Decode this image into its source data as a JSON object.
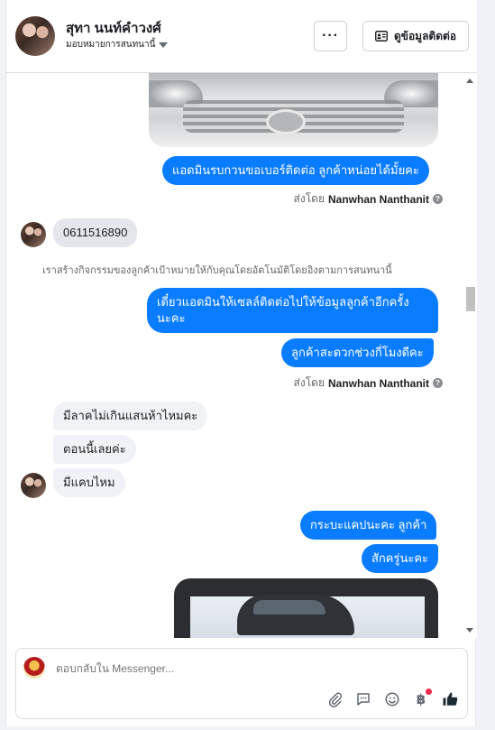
{
  "header": {
    "name": "สุทา นนท์คำวงศ์",
    "assign_label": "มอบหมายการสนทนานี้",
    "more_label": "···",
    "contact_label": "ดูข้อมูลติดต่อ"
  },
  "messages": {
    "out1": "แอดมินรบกวนขอเบอร์ติดต่อ ลูกค้าหน่อยได้มั้ยคะ",
    "sent_by_prefix": "ส่งโดย",
    "sent_by_name": "Nanwhan Nanthanit",
    "in_phone": "0611516890",
    "system_note": "เราสร้างกิจกรรมของลูกค้าเป้าหมายให้กับคุณโดยอัตโนมัติโดยอิงตามการสนทนานี้",
    "out2_line1": "เดี๋ยวแอดมินให้เซลล์ติดต่อไปให้ข้อมูลลูกค้าอีกครั้ง",
    "out2_line2": "นะคะ",
    "out3": "ลูกค้าสะดวกช่วงกี่โมงดีคะ",
    "in2": "มีลาคไม่เกินแสนห้าไหมคะ",
    "in3": "ตอนนี้เลยค่ะ",
    "in4": "มีแคบไหม",
    "out4": "กระบะแคปนะคะ ลูกค้า",
    "out5": "สักครู่นะคะ"
  },
  "composer": {
    "placeholder": "ตอบกลับใน Messenger..."
  },
  "icons": {
    "attach": "paperclip-icon",
    "saved_replies": "speech-bubble-icon",
    "emoji": "smiley-icon",
    "payment": "baht-icon",
    "like": "thumbs-up-icon"
  },
  "colors": {
    "outgoing_bubble": "#0a7cff",
    "incoming_bubble": "#f0f2f5",
    "like_icon": "#1c2b33",
    "notification_dot": "#f02849"
  }
}
